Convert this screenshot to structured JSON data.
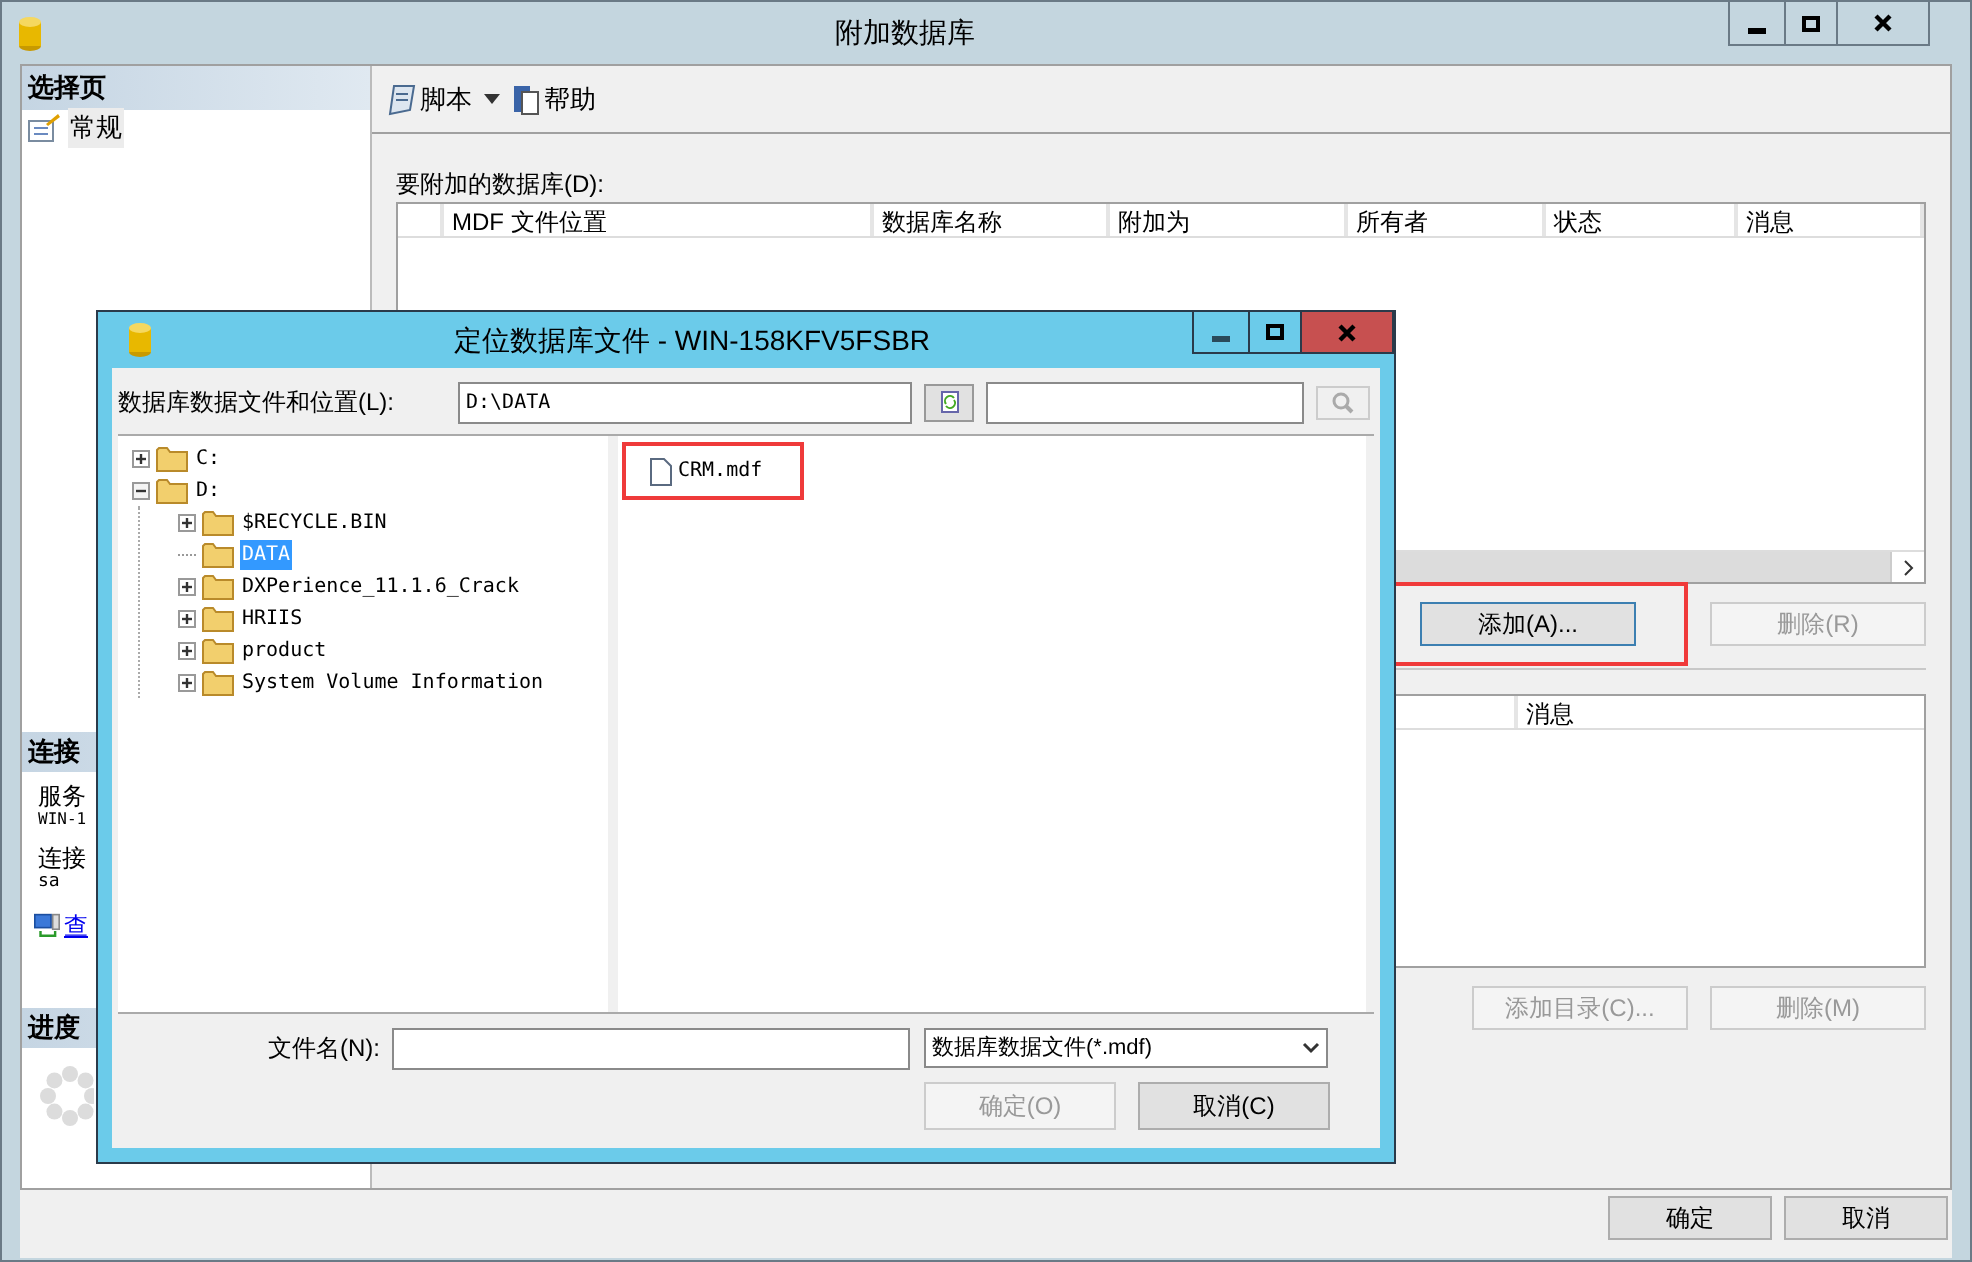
{
  "window": {
    "title": "附加数据库"
  },
  "sidebar": {
    "header": "选择页",
    "items": [
      {
        "label": "常规",
        "selected": true
      }
    ]
  },
  "connection": {
    "header": "连接",
    "server_label": "服务",
    "server": "WIN-1",
    "login_label": "连接",
    "login": "sa",
    "link": "查"
  },
  "progress": {
    "header": "进度"
  },
  "toolbar": {
    "items": [
      {
        "label": "脚本",
        "kind": "script"
      },
      {
        "label": "帮助",
        "kind": "help"
      }
    ]
  },
  "attach": {
    "label": "要附加的数据库(D):",
    "columns": [
      "MDF 文件位置",
      "数据库名称",
      "附加为",
      "所有者",
      "状态",
      "消息"
    ],
    "buttons": [
      {
        "label": "添加(A)...",
        "disabled": false,
        "highlighted": true
      },
      {
        "label": "删除(R)",
        "disabled": true,
        "highlighted": false
      }
    ]
  },
  "details": {
    "columns": [
      "消息"
    ],
    "buttons": [
      {
        "label": "添加目录(C)...",
        "disabled": true
      },
      {
        "label": "删除(M)",
        "disabled": true
      }
    ]
  },
  "footer_buttons": [
    {
      "label": "确定",
      "disabled": false
    },
    {
      "label": "取消",
      "disabled": false
    }
  ],
  "dialog": {
    "title": "定位数据库文件 - WIN-158KFV5FSBR",
    "location_label": "数据库数据文件和位置(L):",
    "location": "D:\\DATA",
    "tree": [
      {
        "label": "C:",
        "expanded": false,
        "selected": false
      },
      {
        "label": "D:",
        "expanded": true,
        "selected": false,
        "children": [
          {
            "label": "$RECYCLE.BIN",
            "expanded": false,
            "selected": false
          },
          {
            "label": "DATA",
            "selected": true
          },
          {
            "label": "DXPerience_11.1.6_Crack",
            "expanded": false,
            "selected": false
          },
          {
            "label": "HRIIS",
            "expanded": false,
            "selected": false
          },
          {
            "label": "product",
            "expanded": false,
            "selected": false
          },
          {
            "label": "System Volume Information",
            "expanded": false,
            "selected": false
          }
        ]
      }
    ],
    "files": [
      {
        "name": "CRM.mdf",
        "highlighted": true
      }
    ],
    "filename_label": "文件名(N):",
    "file_type": "数据库数据文件(*.mdf)",
    "buttons": [
      {
        "label": "确定(O)",
        "disabled": true
      },
      {
        "label": "取消(C)",
        "disabled": false
      }
    ]
  }
}
